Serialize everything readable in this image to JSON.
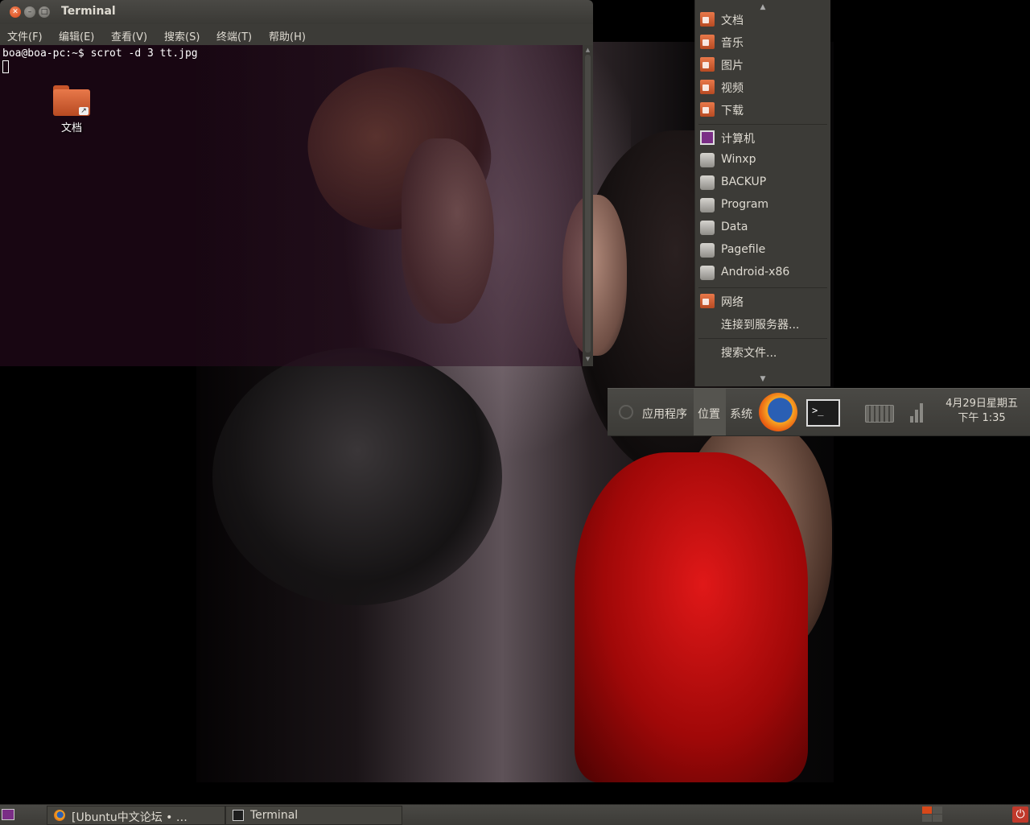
{
  "terminal": {
    "title": "Terminal",
    "menu": [
      "文件(F)",
      "编辑(E)",
      "查看(V)",
      "搜索(S)",
      "终端(T)",
      "帮助(H)"
    ],
    "prompt_line": "boa@boa-pc:~$ scrot -d 3 tt.jpg"
  },
  "desktop": {
    "icons": [
      {
        "label": "文档",
        "icon": "folder-link-icon"
      }
    ]
  },
  "places_menu": {
    "items": [
      {
        "label": "文档",
        "icon": "folder-documents-icon"
      },
      {
        "label": "音乐",
        "icon": "folder-music-icon"
      },
      {
        "label": "图片",
        "icon": "folder-pictures-icon"
      },
      {
        "label": "视频",
        "icon": "folder-videos-icon"
      },
      {
        "label": "下载",
        "icon": "folder-download-icon"
      },
      {
        "label": "计算机",
        "icon": "computer-icon"
      },
      {
        "label": "Winxp",
        "icon": "drive-icon"
      },
      {
        "label": "BACKUP",
        "icon": "drive-icon"
      },
      {
        "label": "Program",
        "icon": "drive-icon"
      },
      {
        "label": "Data",
        "icon": "drive-icon"
      },
      {
        "label": "Pagefile",
        "icon": "drive-icon"
      },
      {
        "label": "Android-x86",
        "icon": "drive-icon"
      },
      {
        "label": "网络",
        "icon": "network-folder-icon"
      },
      {
        "label": "连接到服务器...",
        "icon": ""
      },
      {
        "label": "搜索文件...",
        "icon": ""
      }
    ]
  },
  "panel": {
    "menus": [
      "应用程序",
      "位置",
      "系统"
    ],
    "active_menu": "位置",
    "launchers": [
      "firefox-icon",
      "terminal-icon"
    ],
    "clock_date": "4月29日星期五",
    "clock_time": "下午  1:35"
  },
  "taskbar": {
    "tasks": [
      {
        "label": "[Ubuntu中文论坛 • …",
        "icon": "firefox-icon"
      },
      {
        "label": "Terminal",
        "icon": "terminal-icon"
      }
    ]
  },
  "colors": {
    "accent_orange": "#d6481a",
    "panel_bg": "#3c3b37",
    "menu_text": "#dfdbd2",
    "terminal_bg": "#2c0a1e"
  }
}
